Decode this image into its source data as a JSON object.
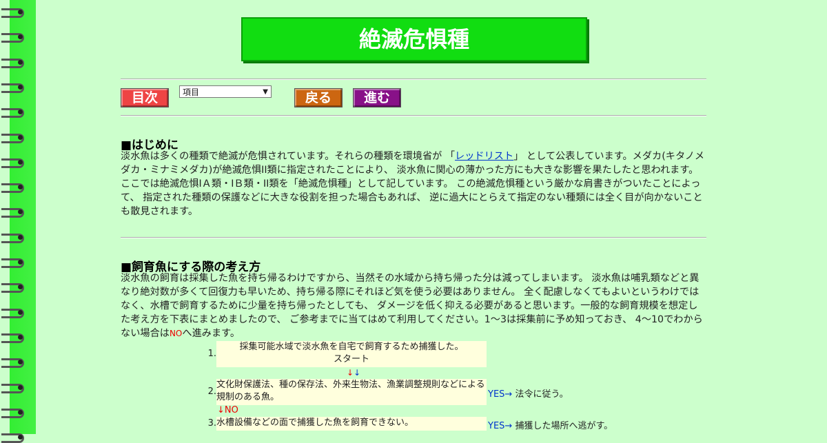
{
  "header": {
    "title": "絶滅危惧種"
  },
  "nav": {
    "index_label": "目次",
    "select_value": "項目",
    "back_label": "戻る",
    "next_label": "進む",
    "colors": {
      "index": "#ee4444",
      "back": "#cc6611",
      "next": "#881188"
    }
  },
  "section1": {
    "heading": "■はじめに",
    "text_before_link": "淡水魚は多くの種類で絶滅が危惧されています。それらの種類を環境省が 「",
    "link": "レッドリスト",
    "text_after_link": "」 として公表しています。メダカ(キタノメダカ・ミナミメダカ)が絶滅危惧II類に指定されたことにより、 淡水魚に関心の薄かった方にも大きな影響を果たしたと思われます。 ここでは絶滅危惧IＡ類・IＢ類・II類を「絶滅危惧種」として記しています。 この絶滅危惧種という厳かな肩書きがついたことによって、 指定された種類の保護などに大きな役割を担った場合もあれば、 逆に過大にとらえて指定のない種類には全く目が向かないことも散見されます。"
  },
  "section2": {
    "heading": "■飼育魚にする際の考え方",
    "text_main": "淡水魚の飼育は採集した魚を持ち帰るわけですから、当然その水域から持ち帰った分は減ってしまいます。 淡水魚は哺乳類などと異なり絶対数が多くて回復力も早いため、持ち帰る際にそれほど気を使う必要はありません。 全く配慮しなくてもよいというわけではなく、水槽で飼育するために少量を持ち帰ったとしても、 ダメージを低く抑える必要があると思います。一般的な飼育規模を想定した考え方を下表にまとめましたので、 ご参考までに当てはめて利用してください。1～3は採集前に予め知っておき、 4～10でわからない場合は",
    "text_no": "NO",
    "text_end": "へ進みます。"
  },
  "flow": {
    "step1_num": "1.",
    "step1_line1": "採集可能水域で淡水魚を自宅で飼育するため捕獲した。",
    "step1_line2": "スタート",
    "step1_arrows": "↓↓",
    "step2_num": "2.",
    "step2_text": "文化財保護法、種の保存法、外来生物法、漁業調整規則などによる規制のある魚。",
    "step2_yes": "YES→",
    "step2_result": "法令に従う。",
    "step2_no": "↓NO",
    "step3_num": "3.",
    "step3_text": "水槽設備などの面で捕獲した魚を飼育できない。",
    "step3_yes": "YES→",
    "step3_result": "捕獲した場所へ逃がす。"
  }
}
